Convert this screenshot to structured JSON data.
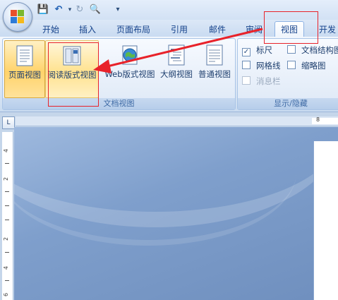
{
  "quick_access": {
    "save": "💾",
    "undo": "↶",
    "redo": "↻",
    "preview": "🔍",
    "dropdown": "▾"
  },
  "tabs": [
    {
      "label": "开始"
    },
    {
      "label": "插入"
    },
    {
      "label": "页面布局"
    },
    {
      "label": "引用"
    },
    {
      "label": "邮件"
    },
    {
      "label": "审阅"
    },
    {
      "label": "视图"
    },
    {
      "label": "开发"
    }
  ],
  "ribbon": {
    "document_views": {
      "label": "文档视图",
      "buttons": [
        {
          "label": "页面视图"
        },
        {
          "label": "阅读版式视图"
        },
        {
          "label": "Web版式视图"
        },
        {
          "label": "大纲视图"
        },
        {
          "label": "普通视图"
        }
      ]
    },
    "show_hide": {
      "label": "显示/隐藏",
      "checkboxes": [
        {
          "label": "标尺",
          "checked": true
        },
        {
          "label": "文档结构图",
          "checked": false
        },
        {
          "label": "网格线",
          "checked": false
        },
        {
          "label": "缩略图",
          "checked": false
        },
        {
          "label": "消息栏",
          "checked": false
        }
      ]
    }
  },
  "ruler": {
    "corner": "L",
    "h_number": "8",
    "v_numbers": [
      "4",
      "2",
      "2",
      "4",
      "6"
    ]
  },
  "colors": {
    "annotation": "#e8222a",
    "ribbon_text": "#15428b"
  }
}
